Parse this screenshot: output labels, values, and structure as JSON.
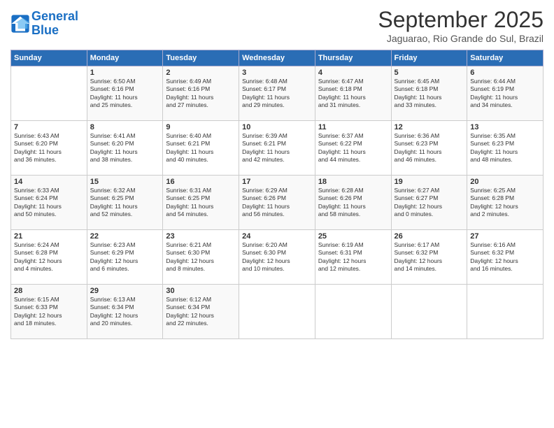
{
  "logo": {
    "line1": "General",
    "line2": "Blue"
  },
  "title": "September 2025",
  "location": "Jaguarao, Rio Grande do Sul, Brazil",
  "days_header": [
    "Sunday",
    "Monday",
    "Tuesday",
    "Wednesday",
    "Thursday",
    "Friday",
    "Saturday"
  ],
  "weeks": [
    [
      {
        "day": "",
        "info": ""
      },
      {
        "day": "1",
        "info": "Sunrise: 6:50 AM\nSunset: 6:16 PM\nDaylight: 11 hours\nand 25 minutes."
      },
      {
        "day": "2",
        "info": "Sunrise: 6:49 AM\nSunset: 6:16 PM\nDaylight: 11 hours\nand 27 minutes."
      },
      {
        "day": "3",
        "info": "Sunrise: 6:48 AM\nSunset: 6:17 PM\nDaylight: 11 hours\nand 29 minutes."
      },
      {
        "day": "4",
        "info": "Sunrise: 6:47 AM\nSunset: 6:18 PM\nDaylight: 11 hours\nand 31 minutes."
      },
      {
        "day": "5",
        "info": "Sunrise: 6:45 AM\nSunset: 6:18 PM\nDaylight: 11 hours\nand 33 minutes."
      },
      {
        "day": "6",
        "info": "Sunrise: 6:44 AM\nSunset: 6:19 PM\nDaylight: 11 hours\nand 34 minutes."
      }
    ],
    [
      {
        "day": "7",
        "info": "Sunrise: 6:43 AM\nSunset: 6:20 PM\nDaylight: 11 hours\nand 36 minutes."
      },
      {
        "day": "8",
        "info": "Sunrise: 6:41 AM\nSunset: 6:20 PM\nDaylight: 11 hours\nand 38 minutes."
      },
      {
        "day": "9",
        "info": "Sunrise: 6:40 AM\nSunset: 6:21 PM\nDaylight: 11 hours\nand 40 minutes."
      },
      {
        "day": "10",
        "info": "Sunrise: 6:39 AM\nSunset: 6:21 PM\nDaylight: 11 hours\nand 42 minutes."
      },
      {
        "day": "11",
        "info": "Sunrise: 6:37 AM\nSunset: 6:22 PM\nDaylight: 11 hours\nand 44 minutes."
      },
      {
        "day": "12",
        "info": "Sunrise: 6:36 AM\nSunset: 6:23 PM\nDaylight: 11 hours\nand 46 minutes."
      },
      {
        "day": "13",
        "info": "Sunrise: 6:35 AM\nSunset: 6:23 PM\nDaylight: 11 hours\nand 48 minutes."
      }
    ],
    [
      {
        "day": "14",
        "info": "Sunrise: 6:33 AM\nSunset: 6:24 PM\nDaylight: 11 hours\nand 50 minutes."
      },
      {
        "day": "15",
        "info": "Sunrise: 6:32 AM\nSunset: 6:25 PM\nDaylight: 11 hours\nand 52 minutes."
      },
      {
        "day": "16",
        "info": "Sunrise: 6:31 AM\nSunset: 6:25 PM\nDaylight: 11 hours\nand 54 minutes."
      },
      {
        "day": "17",
        "info": "Sunrise: 6:29 AM\nSunset: 6:26 PM\nDaylight: 11 hours\nand 56 minutes."
      },
      {
        "day": "18",
        "info": "Sunrise: 6:28 AM\nSunset: 6:26 PM\nDaylight: 11 hours\nand 58 minutes."
      },
      {
        "day": "19",
        "info": "Sunrise: 6:27 AM\nSunset: 6:27 PM\nDaylight: 12 hours\nand 0 minutes."
      },
      {
        "day": "20",
        "info": "Sunrise: 6:25 AM\nSunset: 6:28 PM\nDaylight: 12 hours\nand 2 minutes."
      }
    ],
    [
      {
        "day": "21",
        "info": "Sunrise: 6:24 AM\nSunset: 6:28 PM\nDaylight: 12 hours\nand 4 minutes."
      },
      {
        "day": "22",
        "info": "Sunrise: 6:23 AM\nSunset: 6:29 PM\nDaylight: 12 hours\nand 6 minutes."
      },
      {
        "day": "23",
        "info": "Sunrise: 6:21 AM\nSunset: 6:30 PM\nDaylight: 12 hours\nand 8 minutes."
      },
      {
        "day": "24",
        "info": "Sunrise: 6:20 AM\nSunset: 6:30 PM\nDaylight: 12 hours\nand 10 minutes."
      },
      {
        "day": "25",
        "info": "Sunrise: 6:19 AM\nSunset: 6:31 PM\nDaylight: 12 hours\nand 12 minutes."
      },
      {
        "day": "26",
        "info": "Sunrise: 6:17 AM\nSunset: 6:32 PM\nDaylight: 12 hours\nand 14 minutes."
      },
      {
        "day": "27",
        "info": "Sunrise: 6:16 AM\nSunset: 6:32 PM\nDaylight: 12 hours\nand 16 minutes."
      }
    ],
    [
      {
        "day": "28",
        "info": "Sunrise: 6:15 AM\nSunset: 6:33 PM\nDaylight: 12 hours\nand 18 minutes."
      },
      {
        "day": "29",
        "info": "Sunrise: 6:13 AM\nSunset: 6:34 PM\nDaylight: 12 hours\nand 20 minutes."
      },
      {
        "day": "30",
        "info": "Sunrise: 6:12 AM\nSunset: 6:34 PM\nDaylight: 12 hours\nand 22 minutes."
      },
      {
        "day": "",
        "info": ""
      },
      {
        "day": "",
        "info": ""
      },
      {
        "day": "",
        "info": ""
      },
      {
        "day": "",
        "info": ""
      }
    ]
  ]
}
